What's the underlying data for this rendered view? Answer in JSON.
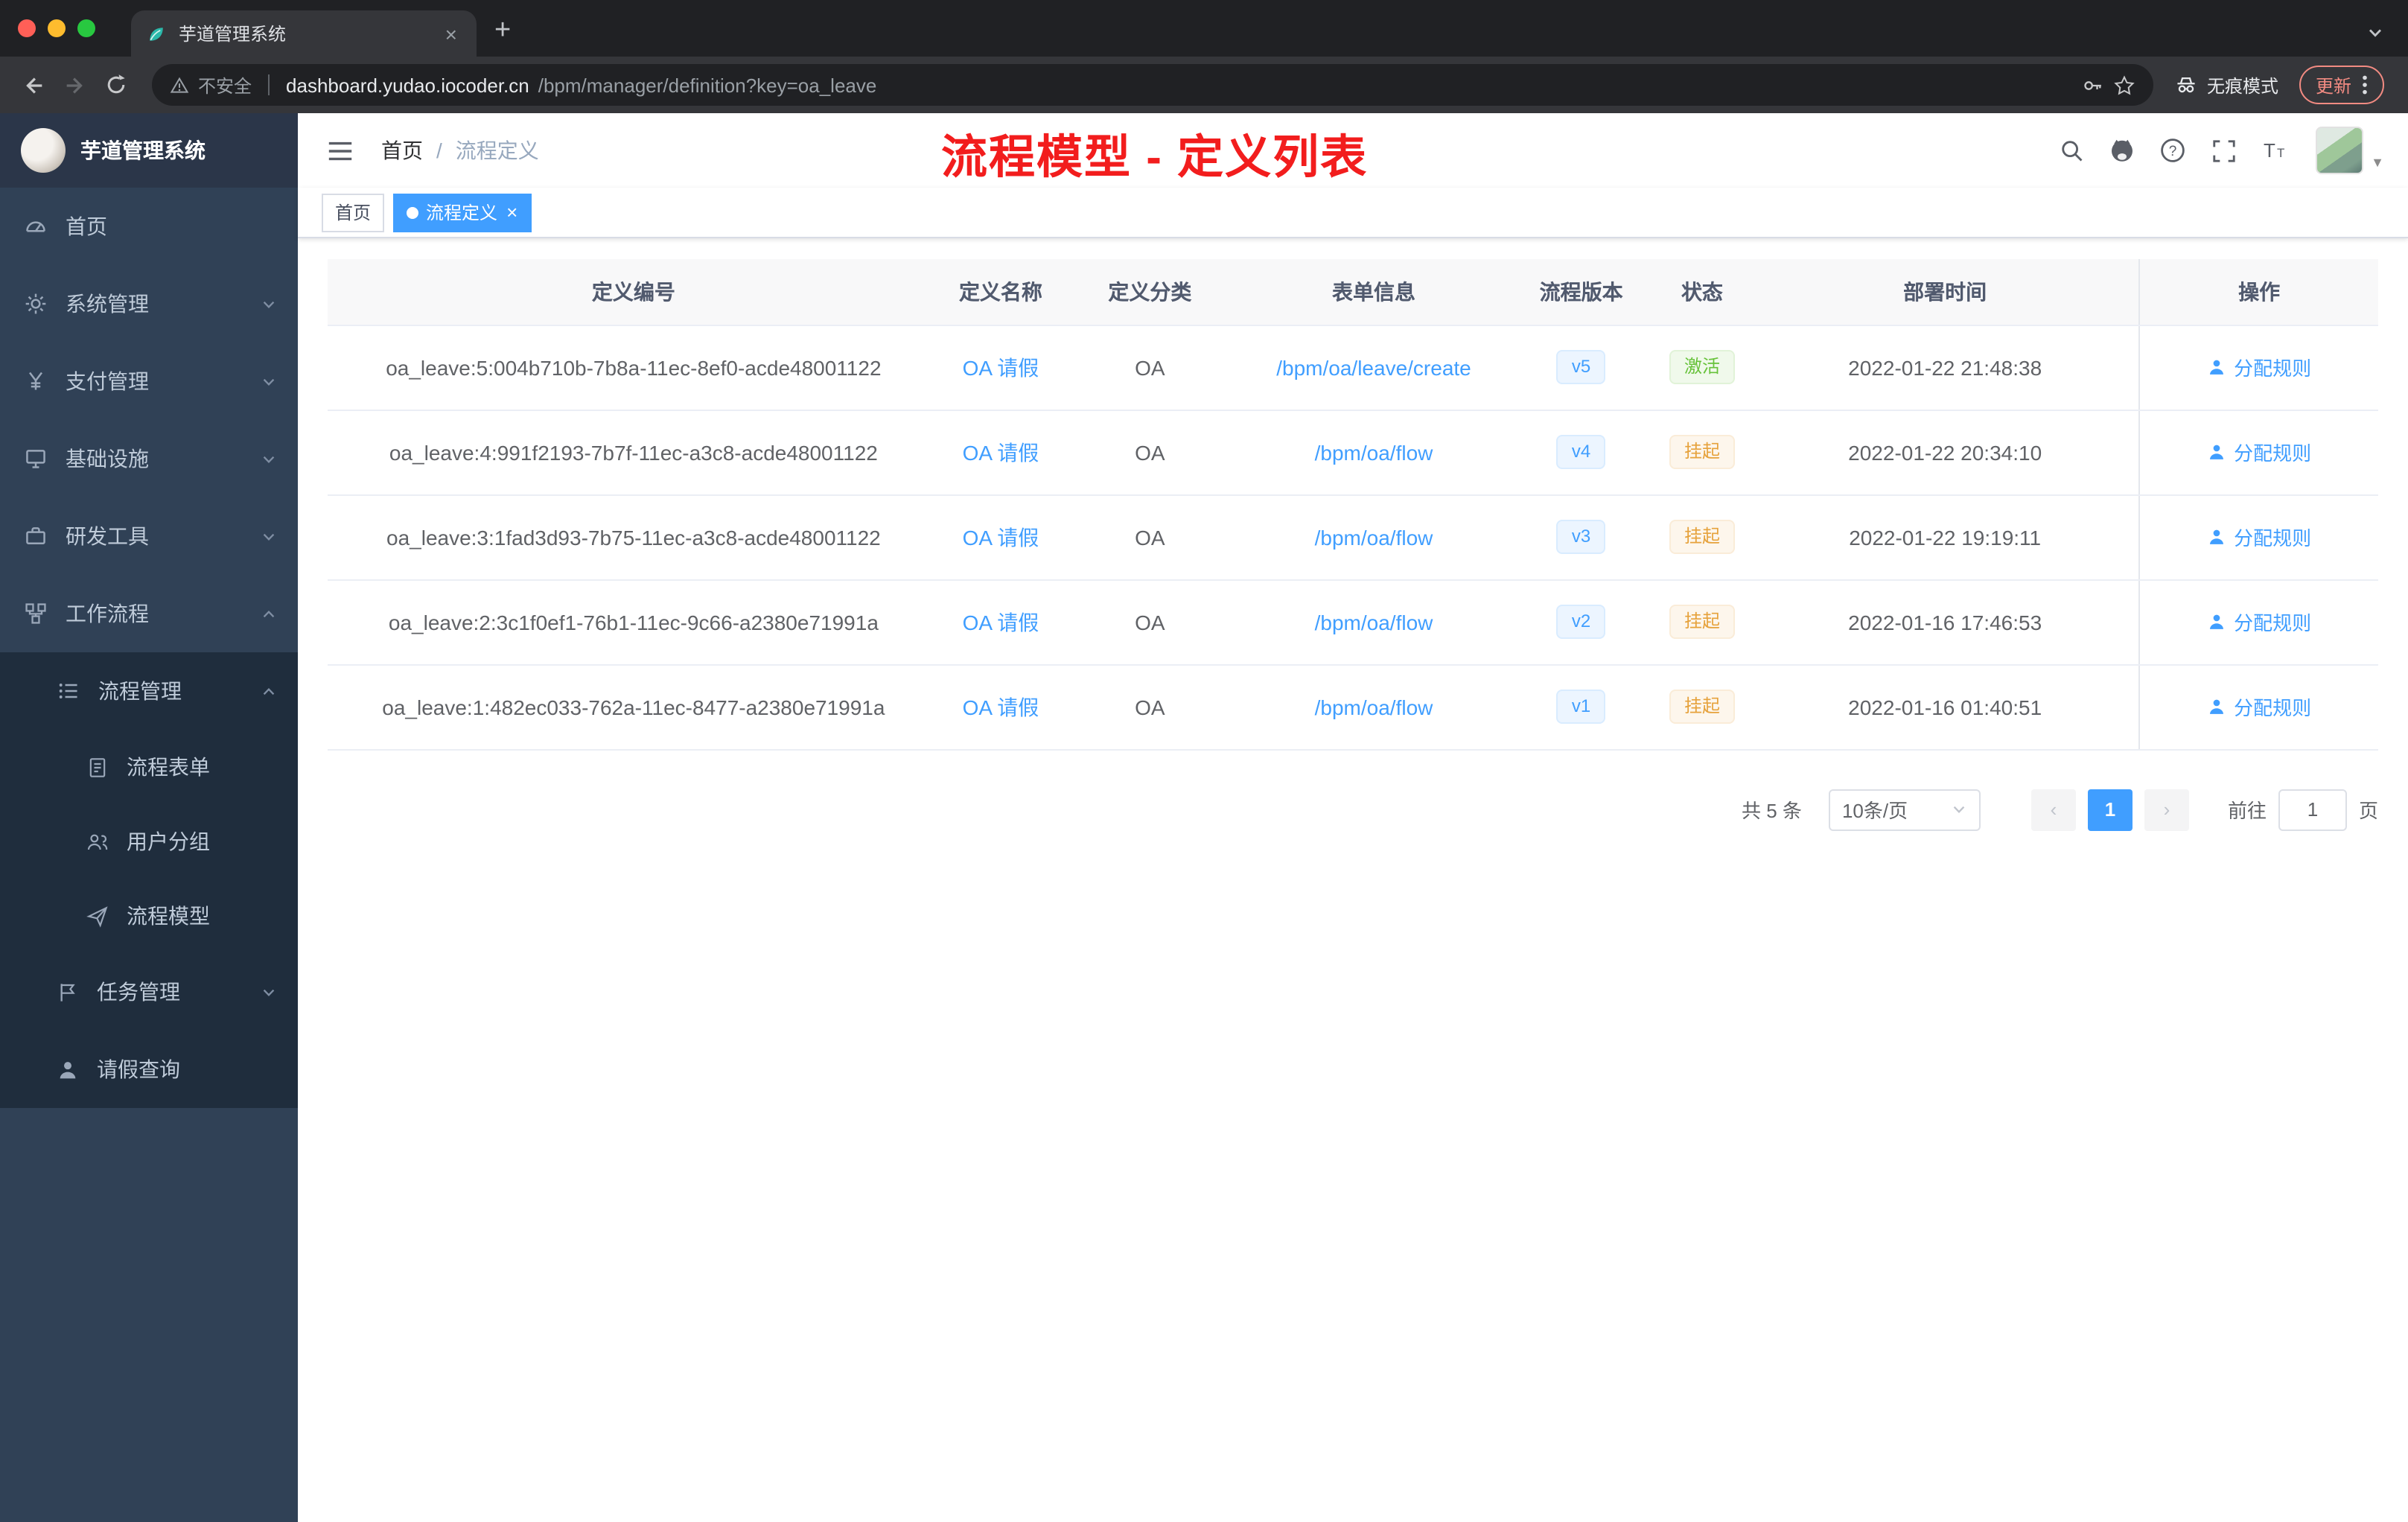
{
  "colors": {
    "primary": "#409eff",
    "success": "#67c23a",
    "warning": "#e6a23c",
    "annotation_red": "#f21d1d",
    "sidebar_bg": "#304156",
    "submenu_bg": "#1f2d3d"
  },
  "browser": {
    "tab": {
      "title": "芋道管理系统",
      "close": "×",
      "new_tab": "+"
    },
    "toolbar": {
      "security_label": "不安全",
      "url_host": "dashboard.yudao.iocoder.cn",
      "url_path": "/bpm/manager/definition?key=oa_leave",
      "incognito_label": "无痕模式",
      "update_label": "更新"
    }
  },
  "sidebar": {
    "app_title": "芋道管理系统",
    "items": [
      {
        "label": "首页"
      },
      {
        "label": "系统管理"
      },
      {
        "label": "支付管理"
      },
      {
        "label": "基础设施"
      },
      {
        "label": "研发工具"
      },
      {
        "label": "工作流程"
      }
    ],
    "workflow_children": {
      "process_mgmt": {
        "label": "流程管理",
        "children": [
          {
            "label": "流程表单"
          },
          {
            "label": "用户分组"
          },
          {
            "label": "流程模型"
          }
        ]
      },
      "task_mgmt": {
        "label": "任务管理"
      },
      "leave_query": {
        "label": "请假查询"
      }
    }
  },
  "navbar": {
    "breadcrumb": {
      "home": "首页",
      "separator": "/",
      "current": "流程定义"
    }
  },
  "annotation": {
    "text": "流程模型 - 定义列表"
  },
  "tags": {
    "home": "首页",
    "active": "流程定义",
    "close": "×"
  },
  "table": {
    "columns": [
      "定义编号",
      "定义名称",
      "定义分类",
      "表单信息",
      "流程版本",
      "状态",
      "部署时间",
      "操作"
    ],
    "rows": [
      {
        "id": "oa_leave:5:004b710b-7b8a-11ec-8ef0-acde48001122",
        "name": "OA 请假",
        "category": "OA",
        "form": "/bpm/oa/leave/create",
        "version": "v5",
        "status": "激活",
        "time": "2022-01-22 21:48:38",
        "action": "分配规则"
      },
      {
        "id": "oa_leave:4:991f2193-7b7f-11ec-a3c8-acde48001122",
        "name": "OA 请假",
        "category": "OA",
        "form": "/bpm/oa/flow",
        "version": "v4",
        "status": "挂起",
        "time": "2022-01-22 20:34:10",
        "action": "分配规则"
      },
      {
        "id": "oa_leave:3:1fad3d93-7b75-11ec-a3c8-acde48001122",
        "name": "OA 请假",
        "category": "OA",
        "form": "/bpm/oa/flow",
        "version": "v3",
        "status": "挂起",
        "time": "2022-01-22 19:19:11",
        "action": "分配规则"
      },
      {
        "id": "oa_leave:2:3c1f0ef1-76b1-11ec-9c66-a2380e71991a",
        "name": "OA 请假",
        "category": "OA",
        "form": "/bpm/oa/flow",
        "version": "v2",
        "status": "挂起",
        "time": "2022-01-16 17:46:53",
        "action": "分配规则"
      },
      {
        "id": "oa_leave:1:482ec033-762a-11ec-8477-a2380e71991a",
        "name": "OA 请假",
        "category": "OA",
        "form": "/bpm/oa/flow",
        "version": "v1",
        "status": "挂起",
        "time": "2022-01-16 01:40:51",
        "action": "分配规则"
      }
    ]
  },
  "pagination": {
    "total": "共 5 条",
    "page_size": "10条/页",
    "prev": "‹",
    "page": "1",
    "next": "›",
    "goto_label": "前往",
    "goto_value": "1",
    "goto_unit": "页"
  }
}
